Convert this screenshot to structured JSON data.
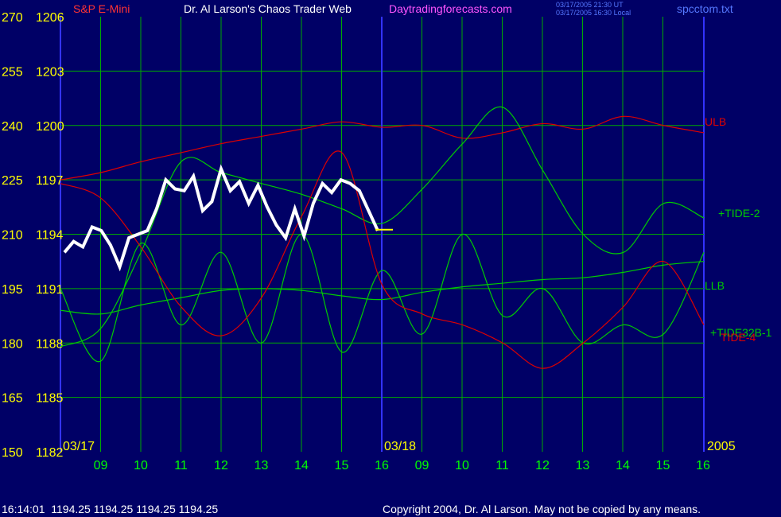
{
  "header": {
    "symbol": "S&P E-Mini",
    "author": "Dr. Al Larson's Chaos Trader Web",
    "site": "Daytradingforecasts.com",
    "stamp_ut": "03/17/2005 21:30 UT",
    "stamp_local": "03/17/2005 16:30 Local",
    "file": "spcctom.txt"
  },
  "footer": {
    "quote": "16:14:01  1194.25 1194.25 1194.25 1194.25",
    "copyright": "Copyright 2004, Dr. Al Larson. May not be copied by any means."
  },
  "colors": {
    "background": "#000066",
    "grid": "#00aa00",
    "price": "#ffffff",
    "down_bars": "#ff0000",
    "tide": "#00cc00",
    "bands": "#dd0000",
    "divider": "#3333ff",
    "y_labels": "#ffff00",
    "x_labels": "#00ff00"
  },
  "chart_data": {
    "type": "line",
    "left_axis": {
      "ticks": [
        150,
        165,
        180,
        195,
        210,
        225,
        240,
        255,
        270
      ],
      "labels": [
        "150",
        "165",
        "180",
        "195",
        "210",
        "225",
        "240",
        "255",
        "270"
      ]
    },
    "price_axis": {
      "ticks": [
        1182,
        1185,
        1188,
        1191,
        1194,
        1197,
        1200,
        1203,
        1206
      ],
      "labels": [
        "1182",
        "1185",
        "1188",
        "1191",
        "1194",
        "1197",
        "1200",
        "1203",
        "1206"
      ],
      "ylim": [
        1182,
        1206
      ]
    },
    "x_axis": {
      "ticks": [
        9,
        10,
        11,
        12,
        13,
        14,
        15,
        16,
        9,
        10,
        11,
        12,
        13,
        14,
        15,
        16
      ],
      "labels": [
        "09",
        "10",
        "11",
        "12",
        "13",
        "14",
        "15",
        "16",
        "09",
        "10",
        "11",
        "12",
        "13",
        "14",
        "15",
        "16"
      ],
      "date_labels": [
        "03/17",
        "03/18"
      ],
      "year": "2005"
    },
    "grid": true,
    "last_price": 1194.25,
    "series": [
      {
        "name": "ULB",
        "color": "#dd0000",
        "values": [
          1197.0,
          1197.4,
          1198.0,
          1198.5,
          1199.0,
          1199.4,
          1199.8,
          1200.2,
          1199.9,
          1200.0,
          1199.3,
          1199.6,
          1200.1,
          1199.8,
          1200.5,
          1200.0,
          1199.6
        ]
      },
      {
        "name": "LLB",
        "color": "#00cc00",
        "values": [
          1189.8,
          1189.6,
          1190.1,
          1190.5,
          1190.9,
          1191.0,
          1190.9,
          1190.6,
          1190.4,
          1190.8,
          1191.1,
          1191.3,
          1191.5,
          1191.6,
          1191.9,
          1192.3,
          1192.5
        ]
      },
      {
        "name": "+TIDE-2",
        "color": "#00cc00",
        "values": [
          1187.8,
          1188.8,
          1193.0,
          1198.0,
          1197.4,
          1196.8,
          1196.2,
          1195.4,
          1194.6,
          1196.5,
          1199.0,
          1201.0,
          1197.5,
          1194.0,
          1193.0,
          1195.7,
          1194.9
        ]
      },
      {
        "name": "+TIDE32B-1",
        "color": "#00cc00",
        "values": [
          1191.0,
          1187.0,
          1193.5,
          1189.0,
          1193.0,
          1188.0,
          1194.0,
          1187.5,
          1192.0,
          1188.5,
          1194.0,
          1189.5,
          1191.0,
          1188.0,
          1189.0,
          1188.5,
          1193.0
        ]
      },
      {
        "name": "TIDE-4",
        "color": "#dd0000",
        "values": [
          1196.8,
          1196.0,
          1193.3,
          1190.0,
          1188.4,
          1190.5,
          1195.0,
          1198.5,
          1191.2,
          1189.6,
          1189.0,
          1188.0,
          1186.6,
          1188.0,
          1190.0,
          1192.5,
          1189.0
        ]
      }
    ]
  }
}
